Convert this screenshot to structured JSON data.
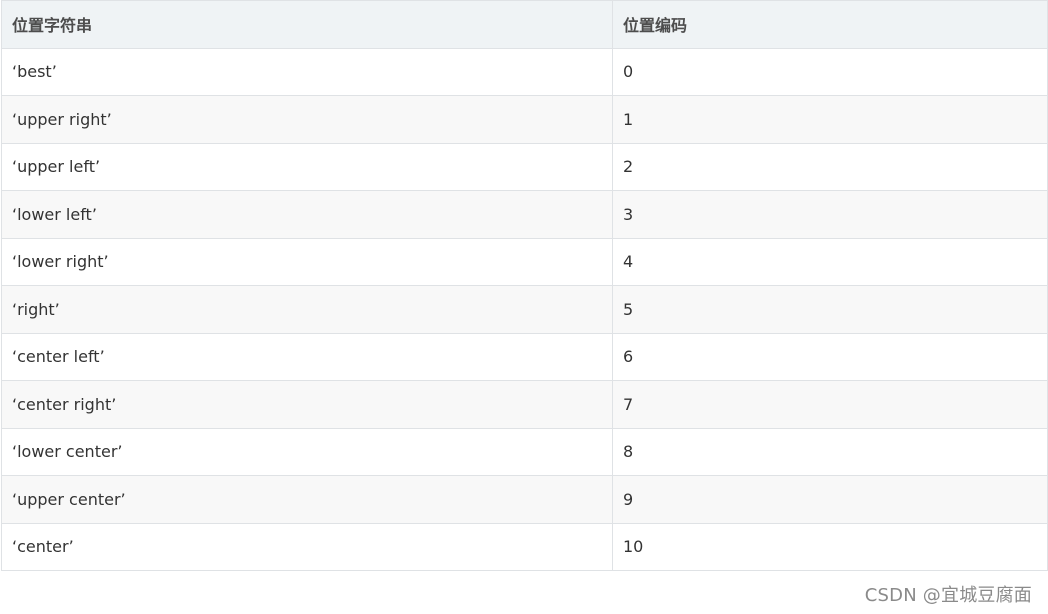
{
  "table": {
    "headers": [
      "位置字符串",
      "位置编码"
    ],
    "rows": [
      [
        "‘best’",
        "0"
      ],
      [
        "‘upper right’",
        "1"
      ],
      [
        "‘upper left’",
        "2"
      ],
      [
        "‘lower left’",
        "3"
      ],
      [
        "‘lower right’",
        "4"
      ],
      [
        "‘right’",
        "5"
      ],
      [
        "‘center left’",
        "6"
      ],
      [
        "‘center right’",
        "7"
      ],
      [
        "‘lower center’",
        "8"
      ],
      [
        "‘upper center’",
        "9"
      ],
      [
        "‘center’",
        "10"
      ]
    ]
  },
  "watermark": "CSDN @宜城豆腐面"
}
